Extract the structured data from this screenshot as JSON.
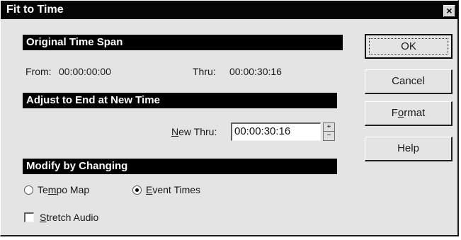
{
  "window": {
    "title": "Fit to Time",
    "close_glyph": "×"
  },
  "original_span": {
    "header": "Original Time Span",
    "from_label": "From:",
    "from_value": "00:00:00:00",
    "thru_label": "Thru:",
    "thru_value": "00:00:30:16"
  },
  "adjust": {
    "header": "Adjust to End at New Time",
    "new_thru_label_pre": "",
    "new_thru_label_mnemonic": "N",
    "new_thru_label_post": "ew Thru:",
    "new_thru_value": "00:00:30:16",
    "spin_up": "+",
    "spin_down": "−"
  },
  "modify": {
    "header": "Modify by Changing",
    "options": [
      {
        "pre": "Te",
        "mnemonic": "m",
        "post": "po Map",
        "checked": false
      },
      {
        "pre": "",
        "mnemonic": "E",
        "post": "vent Times",
        "checked": true
      }
    ],
    "stretch_audio": {
      "pre": "",
      "mnemonic": "S",
      "post": "tretch Audio",
      "checked": false
    }
  },
  "buttons": {
    "ok": "OK",
    "cancel": "Cancel",
    "format_pre": "F",
    "format_mnemonic": "o",
    "format_post": "rmat",
    "help": "Help"
  }
}
